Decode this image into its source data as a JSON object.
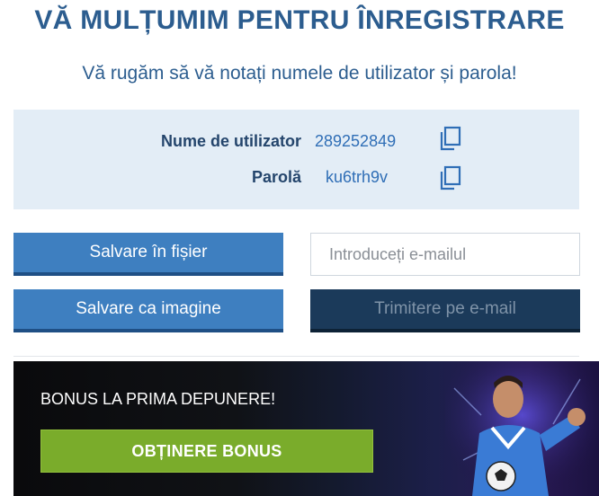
{
  "header": {
    "title": "VĂ MULȚUMIM PENTRU ÎNREGISTRARE",
    "subtitle": "Vă rugăm să vă notați numele de utilizator și parola!"
  },
  "credentials": {
    "username_label": "Nume de utilizator",
    "username_value": "289252849",
    "password_label": "Parolă",
    "password_value": "ku6trh9v",
    "copy_icon": "copy-icon"
  },
  "actions": {
    "save_file_label": "Salvare în fișier",
    "save_image_label": "Salvare ca imagine",
    "email_placeholder": "Introduceți e-mailul",
    "email_value": "",
    "send_email_label": "Trimitere pe e-mail"
  },
  "banner": {
    "headline": "BONUS LA PRIMA DEPUNERE!",
    "button_label": "OBȚINERE BONUS"
  },
  "colors": {
    "title": "#2c5d8f",
    "primary_button": "#3e7fc0",
    "dark_button": "#1b3a5a",
    "bonus_button": "#7aac2b",
    "credentials_bg": "#e3edf6"
  }
}
